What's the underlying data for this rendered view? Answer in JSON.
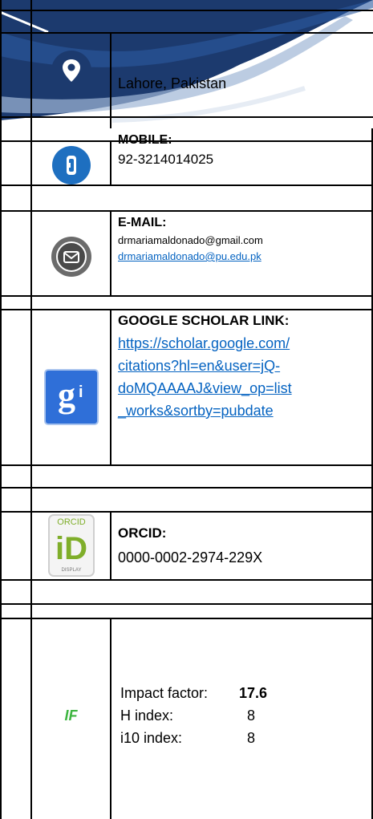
{
  "location": {
    "text": "Lahore, Pakistan",
    "icon": "location-pin-icon"
  },
  "mobile": {
    "label": "MOBILE:",
    "value": "92-3214014025",
    "icon": "phone-icon"
  },
  "email": {
    "label": "E-MAIL:",
    "addresses": [
      "drmariamaldonado@gmail.com",
      "drmariamaldonado@pu.edu.pk"
    ],
    "icon": "mail-icon"
  },
  "scholar": {
    "label": "GOOGLE SCHOLAR LINK:",
    "lines": [
      "https://scholar.google.com/",
      "citations?hl=en&user=jQ-",
      "doMQAAAAJ&view_op=list",
      "_works&sortby=pubdate"
    ],
    "icon": "google-scholar-icon"
  },
  "orcid": {
    "label": "ORCID:",
    "value": "0000-0002-2974-229X",
    "icon": "orcid-icon",
    "logo_top": "ORCID",
    "logo_main": "iD",
    "logo_bottom": "DISPLAY"
  },
  "metrics": {
    "mark": "IF",
    "rows": [
      {
        "label": "Impact factor:",
        "value": "17.6"
      },
      {
        "label": "H index:",
        "value": "8"
      },
      {
        "label": "i10 index:",
        "value": "8"
      }
    ]
  },
  "colors": {
    "banner": "#1c3a6e",
    "link": "#0563c1",
    "if_green": "#3db540",
    "phone_blue": "#1e6fc0"
  }
}
